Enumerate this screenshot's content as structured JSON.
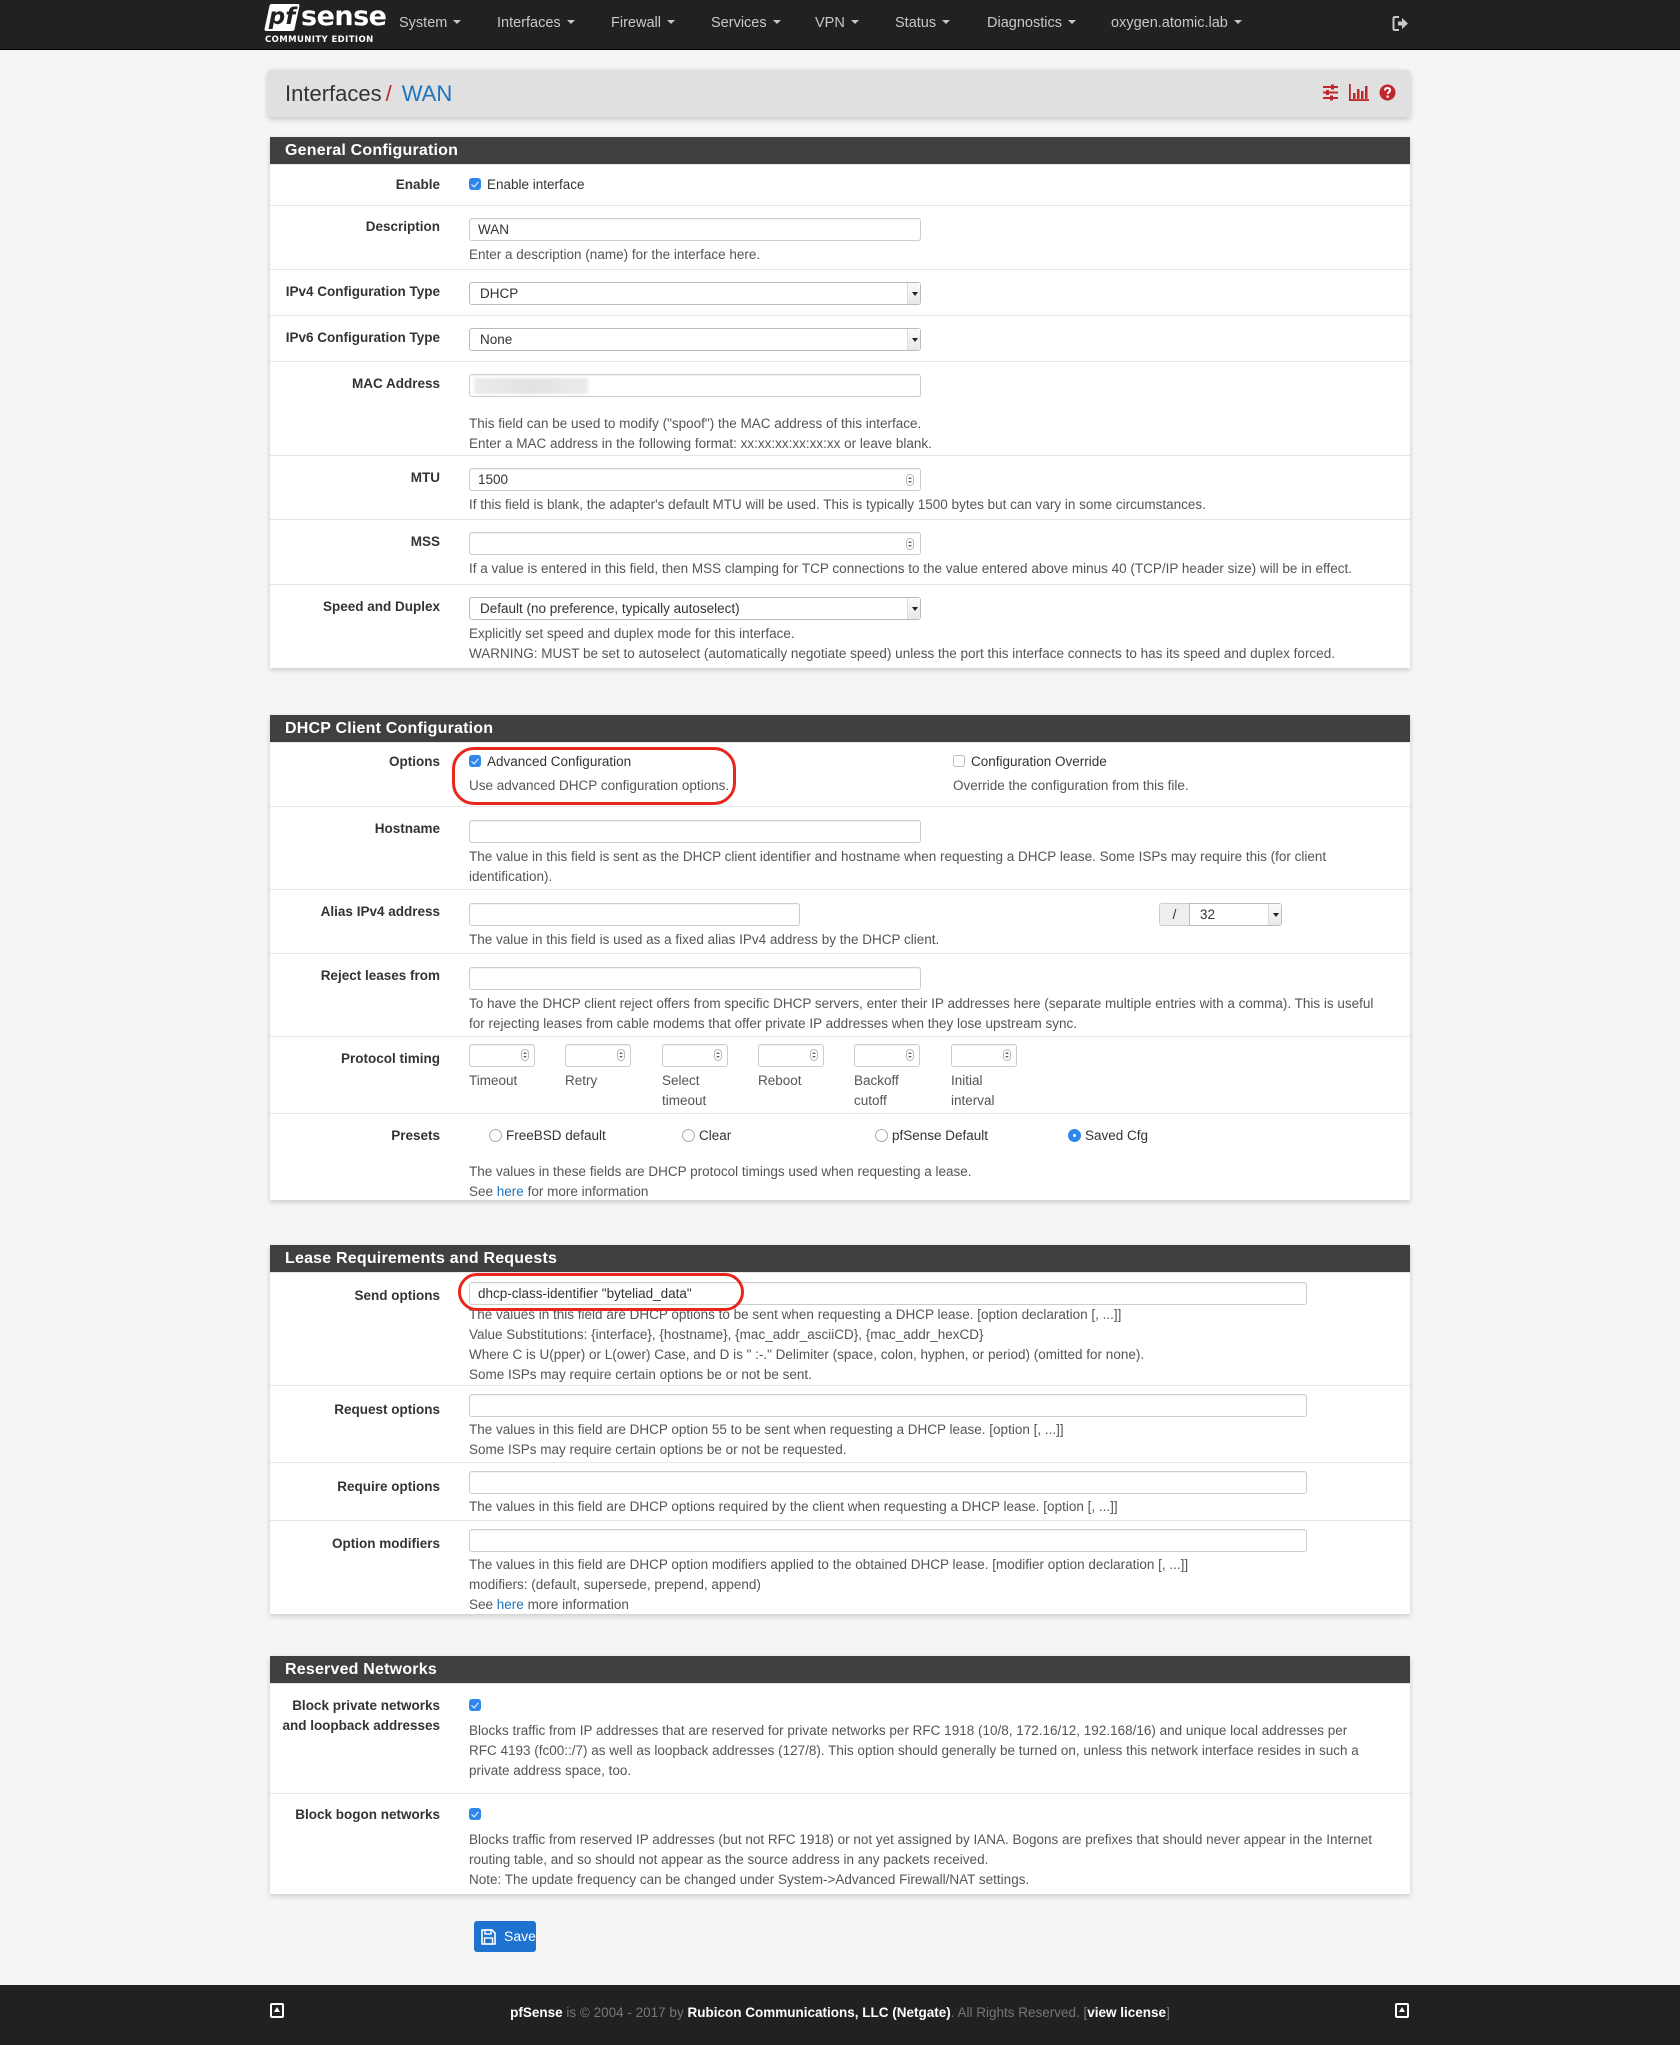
{
  "navbar": {
    "brand": {
      "logo_pf": "pf",
      "logo_sense": "sense",
      "edition": "COMMUNITY EDITION"
    },
    "menu": [
      {
        "label": "System"
      },
      {
        "label": "Interfaces"
      },
      {
        "label": "Firewall"
      },
      {
        "label": "Services"
      },
      {
        "label": "VPN"
      },
      {
        "label": "Status"
      },
      {
        "label": "Diagnostics"
      },
      {
        "label": "oxygen.atomic.lab"
      }
    ],
    "logout_icon": "sign-out-icon"
  },
  "header": {
    "breadcrumb_parent": "Interfaces",
    "breadcrumb_sep": "/",
    "breadcrumb_current": "WAN",
    "icons": [
      "sliders-icon",
      "bar-chart-icon",
      "question-circle-icon"
    ],
    "accent_color": "#c0272d",
    "link_color": "#1e73be"
  },
  "general": {
    "heading": "General Configuration",
    "enable": {
      "label": "Enable",
      "checkbox_label": "Enable interface",
      "checked": true
    },
    "description": {
      "label": "Description",
      "value": "WAN",
      "help": "Enter a description (name) for the interface here."
    },
    "ipv4_type": {
      "label": "IPv4 Configuration Type",
      "value": "DHCP"
    },
    "ipv6_type": {
      "label": "IPv6 Configuration Type",
      "value": "None"
    },
    "mac": {
      "label": "MAC Address",
      "value": "",
      "help1": "This field can be used to modify (\"spoof\") the MAC address of this interface.",
      "help2": "Enter a MAC address in the following format: xx:xx:xx:xx:xx:xx or leave blank."
    },
    "mtu": {
      "label": "MTU",
      "value": "1500",
      "help": "If this field is blank, the adapter's default MTU will be used. This is typically 1500 bytes but can vary in some circumstances."
    },
    "mss": {
      "label": "MSS",
      "value": "",
      "help": "If a value is entered in this field, then MSS clamping for TCP connections to the value entered above minus 40 (TCP/IP header size) will be in effect."
    },
    "speed": {
      "label": "Speed and Duplex",
      "value": "Default (no preference, typically autoselect)",
      "help1": "Explicitly set speed and duplex mode for this interface.",
      "help2": "WARNING: MUST be set to autoselect (automatically negotiate speed) unless the port this interface connects to has its speed and duplex forced."
    }
  },
  "dhcp": {
    "heading": "DHCP Client Configuration",
    "options": {
      "label": "Options",
      "advanced": {
        "label": "Advanced Configuration",
        "checked": true,
        "help": "Use advanced DHCP configuration options."
      },
      "override": {
        "label": "Configuration Override",
        "checked": false,
        "help": "Override the configuration from this file."
      }
    },
    "hostname": {
      "label": "Hostname",
      "value": "",
      "help1": "The value in this field is sent as the DHCP client identifier and hostname when requesting a DHCP lease. Some ISPs may require this (for client",
      "help2": "identification)."
    },
    "alias": {
      "label": "Alias IPv4 address",
      "value": "",
      "slash": "/",
      "cidr": "32",
      "help": "The value in this field is used as a fixed alias IPv4 address by the DHCP client."
    },
    "reject": {
      "label": "Reject leases from",
      "value": "",
      "help1": "To have the DHCP client reject offers from specific DHCP servers, enter their IP addresses here (separate multiple entries with a comma). This is useful",
      "help2": "for rejecting leases from cable modems that offer private IP addresses when they lose upstream sync."
    },
    "timing": {
      "label": "Protocol timing",
      "fields": [
        {
          "line1": "Timeout",
          "line2": "",
          "value": ""
        },
        {
          "line1": "Retry",
          "line2": "",
          "value": ""
        },
        {
          "line1": "Select",
          "line2": "timeout",
          "value": ""
        },
        {
          "line1": "Reboot",
          "line2": "",
          "value": ""
        },
        {
          "line1": "Backoff",
          "line2": "cutoff",
          "value": ""
        },
        {
          "line1": "Initial",
          "line2": "interval",
          "value": ""
        }
      ]
    },
    "presets": {
      "label": "Presets",
      "options": [
        {
          "label": "FreeBSD default",
          "selected": false
        },
        {
          "label": "Clear",
          "selected": false
        },
        {
          "label": "pfSense Default",
          "selected": false
        },
        {
          "label": "Saved Cfg",
          "selected": true
        }
      ],
      "help1": "The values in these fields are DHCP protocol timings used when requesting a lease.",
      "help2_pre": "See ",
      "help2_link": "here",
      "help2_post": " for more information"
    }
  },
  "lease": {
    "heading": "Lease Requirements and Requests",
    "send": {
      "label": "Send options",
      "value": "dhcp-class-identifier \"byteliad_data\"",
      "help1": "The values in this field are DHCP options to be sent when requesting a DHCP lease. [option declaration [, ...]]",
      "help2": "Value Substitutions: {interface}, {hostname}, {mac_addr_asciiCD}, {mac_addr_hexCD}",
      "help3": "Where C is U(pper) or L(ower) Case, and D is \" :-.\" Delimiter (space, colon, hyphen, or period) (omitted for none).",
      "help4": "Some ISPs may require certain options be or not be sent."
    },
    "request": {
      "label": "Request options",
      "value": "",
      "help1": "The values in this field are DHCP option 55 to be sent when requesting a DHCP lease. [option [, ...]]",
      "help2": "Some ISPs may require certain options be or not be requested."
    },
    "require": {
      "label": "Require options",
      "value": "",
      "help1": "The values in this field are DHCP options required by the client when requesting a DHCP lease. [option [, ...]]"
    },
    "modifiers": {
      "label": "Option modifiers",
      "value": "",
      "help1": "The values in this field are DHCP option modifiers applied to the obtained DHCP lease. [modifier option declaration [, ...]]",
      "help2": "modifiers: (default, supersede, prepend, append)",
      "help3_pre": "See ",
      "help3_link": "here",
      "help3_post": " more information"
    }
  },
  "reserved": {
    "heading": "Reserved Networks",
    "private": {
      "label1": "Block private networks",
      "label2": "and loopback addresses",
      "checked": true,
      "help1": "Blocks traffic from IP addresses that are reserved for private networks per RFC 1918 (10/8, 172.16/12, 192.168/16) and unique local addresses per",
      "help2": "RFC 4193 (fc00::/7) as well as loopback addresses (127/8). This option should generally be turned on, unless this network interface resides in such a",
      "help3": "private address space, too."
    },
    "bogon": {
      "label": "Block bogon networks",
      "checked": true,
      "help1": "Blocks traffic from reserved IP addresses (but not RFC 1918) or not yet assigned by IANA. Bogons are prefixes that should never appear in the Internet",
      "help2": "routing table, and so should not appear as the source address in any packets received.",
      "help3": "Note: The update frequency can be changed under System->Advanced Firewall/NAT settings."
    }
  },
  "save_button": {
    "label": "Save",
    "icon": "save-icon",
    "color": "#1e73d0"
  },
  "footer": {
    "brand": "pfSense",
    "text1": " is © 2004 - 2017 by ",
    "company": "Rubicon Communications, LLC (Netgate)",
    "text2": ". All Rights Reserved. [",
    "license_link": "view license",
    "text3": "]"
  }
}
